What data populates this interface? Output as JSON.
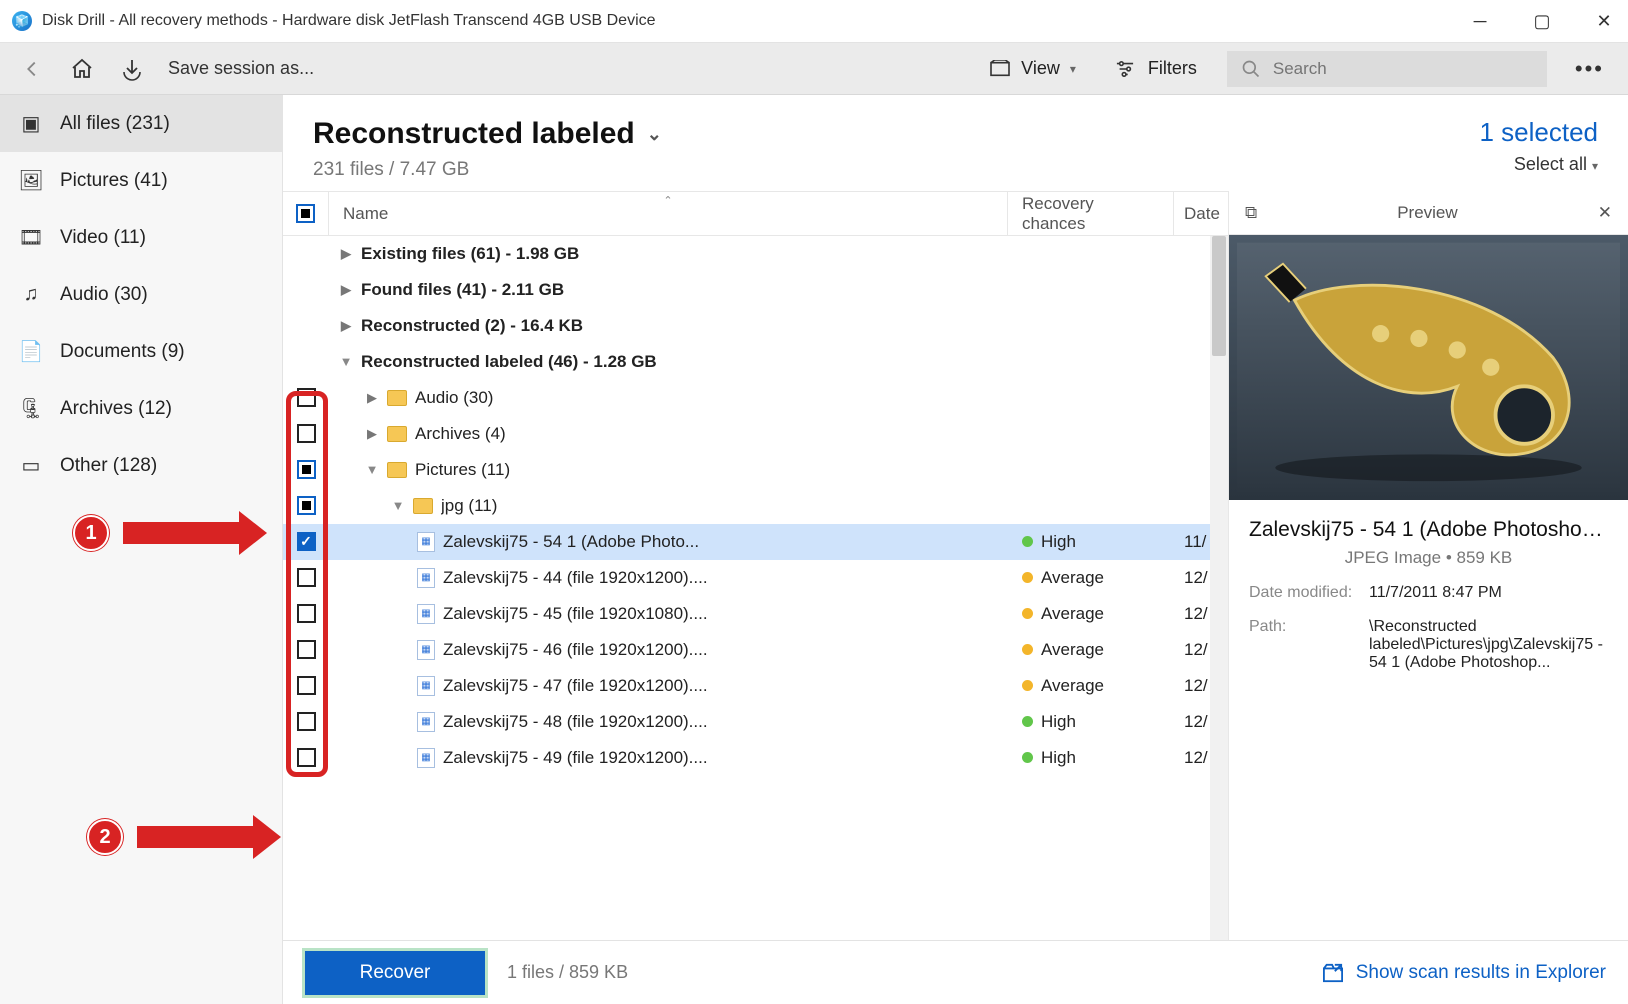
{
  "window": {
    "title": "Disk Drill - All recovery methods - Hardware disk JetFlash Transcend 4GB USB Device"
  },
  "toolbar": {
    "save_session": "Save session as...",
    "view": "View",
    "filters": "Filters",
    "search_placeholder": "Search"
  },
  "sidebar": {
    "items": [
      {
        "icon": "stack",
        "label": "All files (231)"
      },
      {
        "icon": "image",
        "label": "Pictures (41)"
      },
      {
        "icon": "video",
        "label": "Video (11)"
      },
      {
        "icon": "audio",
        "label": "Audio (30)"
      },
      {
        "icon": "doc",
        "label": "Documents (9)"
      },
      {
        "icon": "arch",
        "label": "Archives (12)"
      },
      {
        "icon": "other",
        "label": "Other (128)"
      }
    ]
  },
  "header": {
    "title": "Reconstructed labeled",
    "subtitle": "231 files / 7.47 GB",
    "selected": "1 selected",
    "select_all": "Select all"
  },
  "columns": {
    "name": "Name",
    "recovery": "Recovery chances",
    "date": "Date"
  },
  "groups": [
    {
      "label": "Existing files (61) - 1.98 GB",
      "expanded": false
    },
    {
      "label": "Found files (41) - 2.11 GB",
      "expanded": false
    },
    {
      "label": "Reconstructed (2) - 16.4 KB",
      "expanded": false
    },
    {
      "label": "Reconstructed labeled (46) - 1.28 GB",
      "expanded": true
    }
  ],
  "folders": [
    {
      "label": "Audio (30)",
      "expanded": false,
      "check": "empty"
    },
    {
      "label": "Archives (4)",
      "expanded": false,
      "check": "empty"
    },
    {
      "label": "Pictures (11)",
      "expanded": true,
      "check": "ind"
    },
    {
      "label": "jpg (11)",
      "expanded": true,
      "check": "ind",
      "sub": true
    }
  ],
  "files": [
    {
      "name": "Zalevskij75 - 54 1 (Adobe Photo...",
      "chance": "High",
      "chance_cls": "high",
      "date": "11/",
      "check": "checked",
      "selected": true
    },
    {
      "name": "Zalevskij75 - 44 (file 1920x1200)....",
      "chance": "Average",
      "chance_cls": "avg",
      "date": "12/",
      "check": "empty"
    },
    {
      "name": "Zalevskij75 - 45 (file 1920x1080)....",
      "chance": "Average",
      "chance_cls": "avg",
      "date": "12/",
      "check": "empty"
    },
    {
      "name": "Zalevskij75 - 46 (file 1920x1200)....",
      "chance": "Average",
      "chance_cls": "avg",
      "date": "12/",
      "check": "empty"
    },
    {
      "name": "Zalevskij75 - 47 (file 1920x1200)....",
      "chance": "Average",
      "chance_cls": "avg",
      "date": "12/",
      "check": "empty"
    },
    {
      "name": "Zalevskij75 - 48 (file 1920x1200)....",
      "chance": "High",
      "chance_cls": "high",
      "date": "12/",
      "check": "empty"
    },
    {
      "name": "Zalevskij75 - 49 (file 1920x1200)....",
      "chance": "High",
      "chance_cls": "high",
      "date": "12/",
      "check": "empty"
    }
  ],
  "preview": {
    "title": "Preview",
    "filename": "Zalevskij75 - 54 1 (Adobe Photoshop...",
    "meta_type": "JPEG Image • 859 KB",
    "date_label": "Date modified:",
    "date_value": "11/7/2011 8:47 PM",
    "path_label": "Path:",
    "path_value": "\\Reconstructed labeled\\Pictures\\jpg\\Zalevskij75 - 54 1 (Adobe Photoshop..."
  },
  "footer": {
    "recover": "Recover",
    "summary": "1 files / 859 KB",
    "explorer": "Show scan results in Explorer"
  },
  "annotations": {
    "callout1": "1",
    "callout2": "2"
  }
}
